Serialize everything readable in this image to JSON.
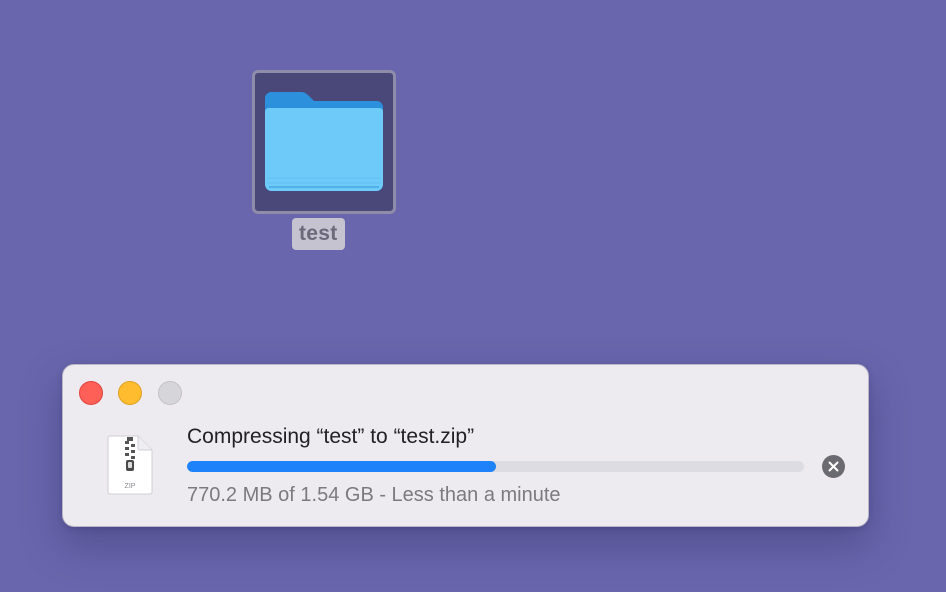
{
  "desktop": {
    "background_color": "#6966ad",
    "folder": {
      "name": "test",
      "icon": "folder-icon",
      "selected": true
    }
  },
  "progress_window": {
    "window_controls": {
      "close": "close-button",
      "minimize": "minimize-button",
      "zoom": "zoom-button"
    },
    "file_icon": {
      "icon": "zip-file-icon",
      "label": "ZIP"
    },
    "title": "Compressing “test” to “test.zip”",
    "progress": 0.5,
    "status": "770.2 MB of 1.54 GB - Less than a minute",
    "cancel_icon": "cancel-icon",
    "colors": {
      "progress_fill": "#1e82fa",
      "progress_track": "#dddce2",
      "close": "#fe5f57",
      "minimize": "#febc2e",
      "zoom": "#d6d5da"
    }
  }
}
